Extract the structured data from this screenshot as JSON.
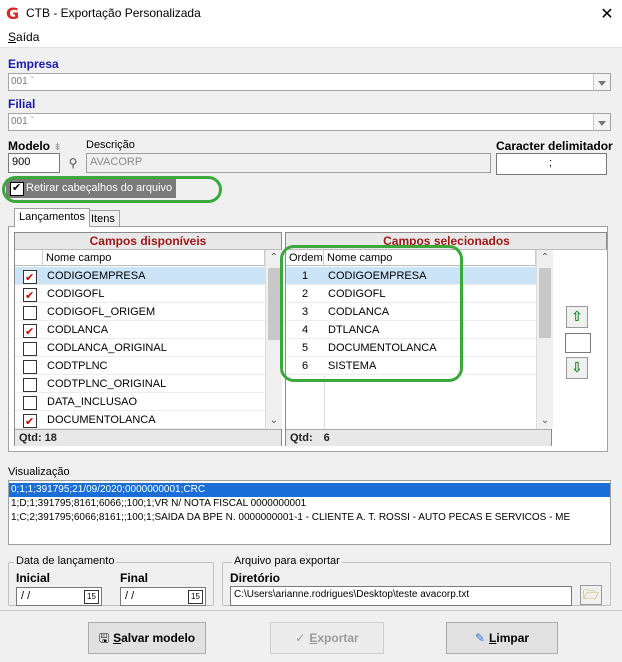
{
  "window": {
    "title": "CTB - Exportação Personalizada",
    "close": "✕"
  },
  "menu": {
    "saida_prefix": "S",
    "saida_rest": "aída"
  },
  "empresa": {
    "label": "Empresa",
    "value": "001 `"
  },
  "filial": {
    "label": "Filial",
    "value": "001 `"
  },
  "modelo": {
    "label": "Modelo",
    "value": "900"
  },
  "descricao": {
    "label": "Descrição",
    "value": "AVACORP"
  },
  "delimitador": {
    "label": "Caracter delimitador",
    "value": ";"
  },
  "retirar": {
    "label": "Retirar cabeçalhos do arquivo",
    "checked": true
  },
  "tabs": [
    {
      "label": "Lançamentos",
      "active": true
    },
    {
      "label": "Itens",
      "active": false
    }
  ],
  "disponiveis": {
    "title": "Campos disponíveis",
    "col_campo": "Nome campo",
    "rows": [
      {
        "name": "CODIGOEMPRESA",
        "checked": true,
        "selected": true
      },
      {
        "name": "CODIGOFL",
        "checked": true,
        "selected": false
      },
      {
        "name": "CODIGOFL_ORIGEM",
        "checked": false,
        "selected": false
      },
      {
        "name": "CODLANCA",
        "checked": true,
        "selected": false
      },
      {
        "name": "CODLANCA_ORIGINAL",
        "checked": false,
        "selected": false
      },
      {
        "name": "CODTPLNC",
        "checked": false,
        "selected": false
      },
      {
        "name": "CODTPLNC_ORIGINAL",
        "checked": false,
        "selected": false
      },
      {
        "name": "DATA_INCLUSAO",
        "checked": false,
        "selected": false
      },
      {
        "name": "DOCUMENTOLANCA",
        "checked": true,
        "selected": false
      }
    ],
    "qtd_label": "Qtd:",
    "qtd_value": "18"
  },
  "selecionados": {
    "title": "Campos selecionados",
    "col_ordem": "Ordem",
    "col_campo": "Nome campo",
    "rows": [
      {
        "ordem": "1",
        "name": "CODIGOEMPRESA",
        "selected": true
      },
      {
        "ordem": "2",
        "name": "CODIGOFL",
        "selected": false
      },
      {
        "ordem": "3",
        "name": "CODLANCA",
        "selected": false
      },
      {
        "ordem": "4",
        "name": "DTLANCA",
        "selected": false
      },
      {
        "ordem": "5",
        "name": "DOCUMENTOLANCA",
        "selected": false
      },
      {
        "ordem": "6",
        "name": "SISTEMA",
        "selected": false
      }
    ],
    "qtd_label": "Qtd:",
    "qtd_value": "6"
  },
  "visualizacao": {
    "label": "Visualização",
    "lines": [
      "0;1;1;391795;21/09/2020;0000000001;CRC",
      "1;D;1;391795;8161;6066;;100;1;VR N/ NOTA FISCAL 0000000001",
      "1;C;2;391795;6066;8161;;100;1;SAIDA DA BPE N. 0000000001-1 - CLIENTE A. T. ROSSI - AUTO PECAS E SERVICOS - ME"
    ]
  },
  "data_lancamento": {
    "legend": "Data de lançamento",
    "inicial_label": "Inicial",
    "final_label": "Final",
    "inicial_value": "/ /",
    "final_value": "/ /",
    "cal": "15"
  },
  "arquivo": {
    "legend": "Arquivo para exportar",
    "diretorio_label": "Diretório",
    "diretorio_value": "C:\\Users\\arianne.rodrigues\\Desktop\\teste avacorp.txt"
  },
  "buttons": {
    "salvar_u": "S",
    "salvar_rest": "alvar modelo",
    "exportar_u": "E",
    "exportar_rest": "xportar",
    "limpar_u": "L",
    "limpar_rest": "impar"
  },
  "colors": {
    "accent_green": "#3aa83a",
    "header_red": "#a01818",
    "label_blue": "#1a1aa8",
    "selection_blue": "#1a6ed6"
  }
}
